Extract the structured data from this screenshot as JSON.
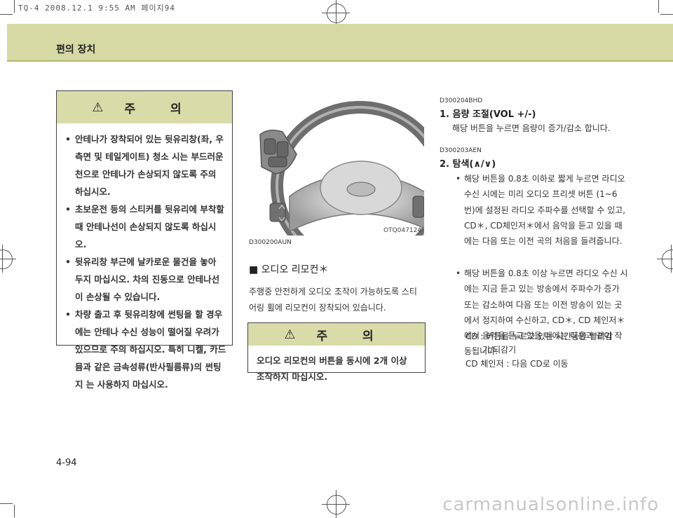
{
  "print_header": "TQ-4 2008.12.1 9:55 AM 페이지94",
  "section_title": "편의 장치",
  "caution_left": {
    "title": "주 의",
    "items": [
      "안테나가 장착되어 있는 뒷유리창(좌, 우 측면 및 테일게이트) 청소 시는 부드러운 천으로 안테나가 손상되지 않도록 주의 하십시오.",
      "초보운전 등의 스티커를 뒷유리에 부착할 때 안테나선이 손상되지 않도록 하십시오.",
      "뒷유리창 부근에 날카로운 물건을 놓아 두지 마십시오. 차의 진동으로 안테나선 이 손상될 수 있습니다.",
      "차량 출고 후 뒷유리창에 썬팅을 할 경우 에는 안테나 수신 성능이 떨어질 우려가 있으므로 주의 하십시오. 특히 니켈, 카드 뮴과 같은 금속성류(반사필름류)의 썬팅지 는 사용하지 마십시오."
    ]
  },
  "figure": {
    "code": "OTQ047124"
  },
  "remote": {
    "code": "D300200AUN",
    "heading": "■ 오디오 리모컨＊",
    "description": "주행중 안전하게 오디오 조작이 가능하도록 스티어링 휠에 리모컨이 장착되어 있습니다."
  },
  "caution_mid": {
    "title": "주 의",
    "body": "오디오 리모컨의 버튼을 동시에 2개 이상 조작하지 마십시오."
  },
  "volume": {
    "code": "D300204BHD",
    "heading": "1. 음량 조절(VOL +/-)",
    "text": "해당 버튼을 누르면 음량이 증가/감소 합니다."
  },
  "seek": {
    "code": "D300203AEN",
    "heading": "2. 탐색(∧/∨)",
    "items": [
      "해당 버튼을 0.8초 이하로 짧게 누르면 라디오 수신 시에는 미리 오디오 프리셋 버튼 (1~6번)에 설정된 라디오 주파수를 선택할 수 있고, CD＊, CD체인저＊에서 음악을 듣고 있을 때에는 다음 또는 이전 곡의 처음을 들려줍니다.",
      "해당 버튼을 0.8초 이상 누르면 라디오 수신 시에는 지금 듣고 있는 방송에서 주파수가 증가 또는 감소하여 다음 또는 이전 방송이 있는 곳에서 정지하여 수신하고, CD＊, CD 체인저＊에서 음악을 듣고 있을 때에는 다음과 같이 작동됩니다."
    ],
    "cd_line1": "CD : 버튼을 누르고 있는 시간동안 빨리감",
    "cd_line2": "기/되감기",
    "changer_line": "CD 체인저 : 다음 CD로 이동"
  },
  "page_number": "4-94",
  "watermark": "carmanualsonline.info"
}
